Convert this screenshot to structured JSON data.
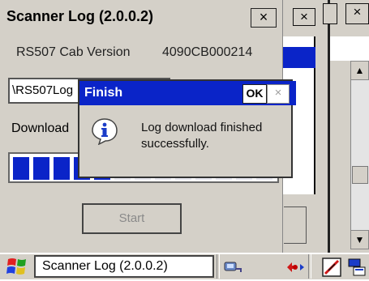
{
  "main_window": {
    "title": "Scanner Log (2.0.0.2)",
    "close_label": "×",
    "version_label": "RS507 Cab Version",
    "version_value": "4090CB000214",
    "path_value": "\\RS507Log",
    "download_label": "Download",
    "progress_fraction": 0.4,
    "start_label": "Start"
  },
  "background_window": {
    "close_label_1": "×",
    "close_label_2": "×",
    "scroll_up": "▲",
    "scroll_down": "▼"
  },
  "dialog": {
    "title": "Finish",
    "ok_label": "OK",
    "close_label": "×",
    "message": "Log download finished successfully.",
    "icon": "info-icon"
  },
  "taskbar": {
    "task_label": "Scanner Log (2.0.0.2)",
    "icons": [
      "windows-start-icon",
      "network-icon",
      "activesync-icon",
      "pen-disabled-icon",
      "input-panel-icon"
    ]
  },
  "colors": {
    "title_blue": "#0a24c8",
    "window_gray": "#d4d0c8"
  }
}
